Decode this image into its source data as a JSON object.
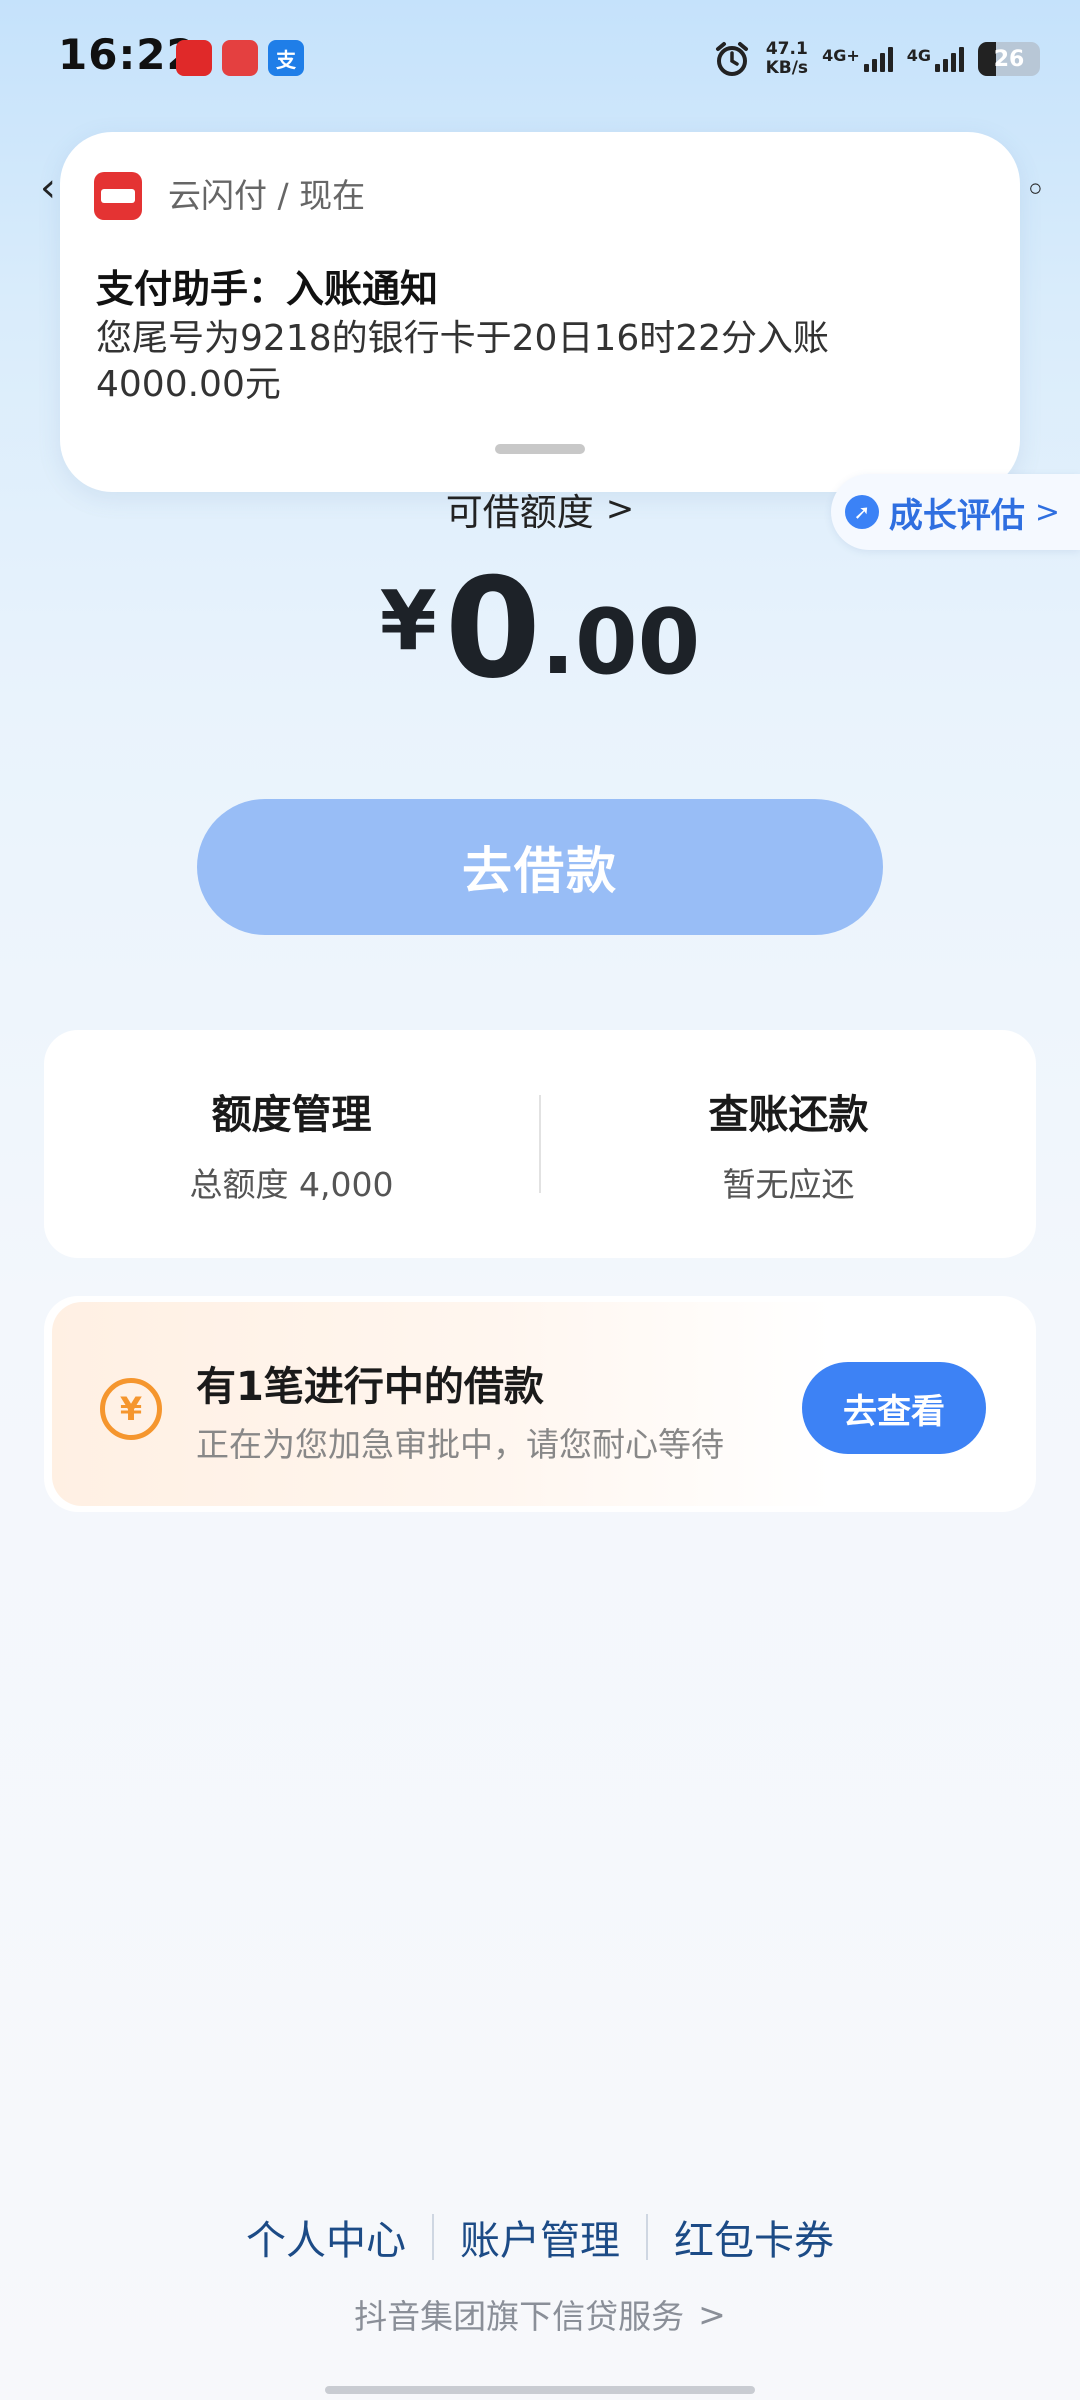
{
  "status_bar": {
    "time": "16:22",
    "app_icons": [
      "unionpay-app-icon",
      "game-app-icon",
      "alipay-icon"
    ],
    "alipay_glyph": "支",
    "net_speed_value": "47.1",
    "net_speed_unit": "KB/s",
    "sim1_label": "4G+",
    "sim2_label": "4G",
    "battery": "26"
  },
  "notification": {
    "app_name": "云闪付 / 现在",
    "title": "支付助手：入账通知",
    "body": "您尾号为9218的银行卡于20日16时22分入账4000.00元"
  },
  "credit": {
    "label": "可借额度",
    "chevron": ">",
    "growth_label": "成长评估",
    "growth_chevron": ">",
    "currency": "¥",
    "amount_integer": "0",
    "amount_decimal": ".00",
    "borrow_button": "去借款"
  },
  "summary": {
    "limit_title": "额度管理",
    "limit_sub": "总额度 4,000",
    "repay_title": "查账还款",
    "repay_sub": "暂无应还"
  },
  "loan": {
    "icon_glyph": "¥",
    "title": "有1笔进行中的借款",
    "subtitle": "正在为您加急审批中，请您耐心等待",
    "button": "去查看"
  },
  "footer": {
    "links": [
      "个人中心",
      "账户管理",
      "红包卡券"
    ],
    "note": "抖音集团旗下信贷服务",
    "note_chevron": ">"
  },
  "colors": {
    "primary": "#3d82f5",
    "button_disabled": "#98bdf6",
    "accent_orange": "#f5962e",
    "link": "#1c4b86"
  }
}
